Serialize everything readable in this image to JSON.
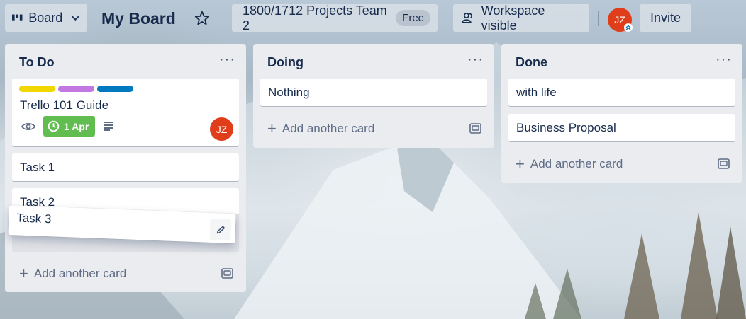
{
  "topbar": {
    "view_label": "Board",
    "board_title": "My Board",
    "workspace_name": "1800/1712 Projects Team 2",
    "plan_badge": "Free",
    "visibility_label": "Workspace visible",
    "member_initials": "JZ",
    "invite_label": "Invite"
  },
  "lists": [
    {
      "title": "To Do",
      "menu": "···",
      "add_card_label": "Add another card",
      "cards": [
        {
          "title": "Trello 101 Guide",
          "labels": [
            "#f2d600",
            "#c377e0",
            "#0079bf"
          ],
          "due_date": "1 Apr",
          "member_initials": "JZ"
        },
        {
          "title": "Task 1"
        },
        {
          "title": "Task 2"
        }
      ]
    },
    {
      "title": "Doing",
      "menu": "···",
      "add_card_label": "Add another card",
      "cards": [
        {
          "title": "Nothing"
        }
      ]
    },
    {
      "title": "Done",
      "menu": "···",
      "add_card_label": "Add another card",
      "cards": [
        {
          "title": "with life"
        },
        {
          "title": "Business Proposal"
        }
      ]
    }
  ],
  "dragging_card": {
    "title": "Task 3"
  },
  "colors": {
    "list_bg": "#ebecf0",
    "date_badge": "#61bd4f",
    "avatar": "#e03e1a"
  }
}
